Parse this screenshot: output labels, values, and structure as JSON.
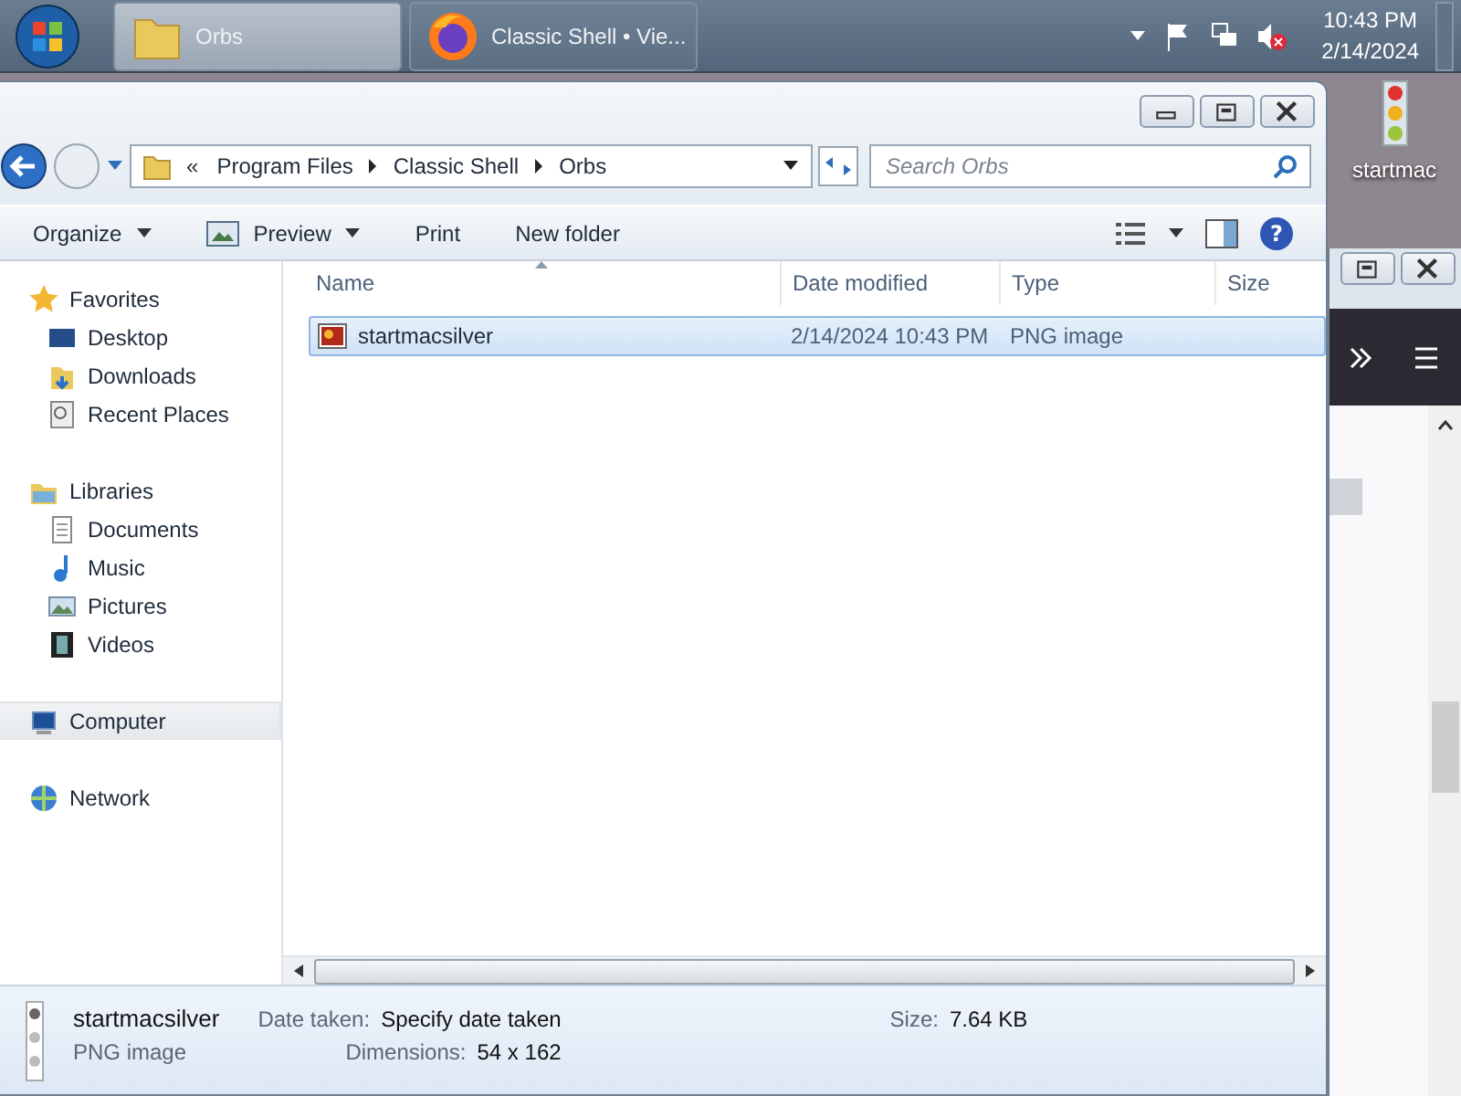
{
  "taskbar": {
    "tasks": [
      {
        "label": "Orbs",
        "selected": true
      },
      {
        "label": "Classic Shell • Vie...",
        "selected": false
      }
    ],
    "clock": {
      "time": "10:43 PM",
      "date": "2/14/2024"
    }
  },
  "desktop_icon": {
    "label": "startmac"
  },
  "explorer": {
    "address": {
      "overflow": "«",
      "crumbs": [
        "Program Files",
        "Classic Shell",
        "Orbs"
      ]
    },
    "search": {
      "placeholder": "Search Orbs"
    },
    "toolbar": [
      {
        "label": "Organize",
        "dropdown": true
      },
      {
        "label": "Preview",
        "dropdown": true
      },
      {
        "label": "Print",
        "dropdown": false
      },
      {
        "label": "New folder",
        "dropdown": false
      }
    ],
    "sidebar": [
      {
        "label": "Favorites",
        "selected": false,
        "children": [
          {
            "label": "Desktop",
            "selected": false
          },
          {
            "label": "Downloads",
            "selected": false
          },
          {
            "label": "Recent Places",
            "selected": false
          }
        ]
      },
      {
        "label": "Libraries",
        "selected": false,
        "children": [
          {
            "label": "Documents",
            "selected": false
          },
          {
            "label": "Music",
            "selected": false
          },
          {
            "label": "Pictures",
            "selected": false
          },
          {
            "label": "Videos",
            "selected": false
          }
        ]
      },
      {
        "label": "Computer",
        "selected": true
      },
      {
        "label": "Network",
        "selected": false
      }
    ],
    "help_label": "?",
    "columns": [
      "Name",
      "Date modified",
      "Type",
      "Size"
    ],
    "rows": [
      {
        "name": "startmacsilver",
        "date": "2/14/2024 10:43 PM",
        "type": "PNG image",
        "selected": true
      }
    ],
    "details": {
      "name": "startmacsilver",
      "type": "PNG image",
      "fields": [
        {
          "label": "Date taken:",
          "value": "Specify date taken"
        },
        {
          "label": "Dimensions:",
          "value": "54 x 162"
        },
        {
          "label": "Size:",
          "value": "7.64 KB"
        }
      ]
    }
  }
}
